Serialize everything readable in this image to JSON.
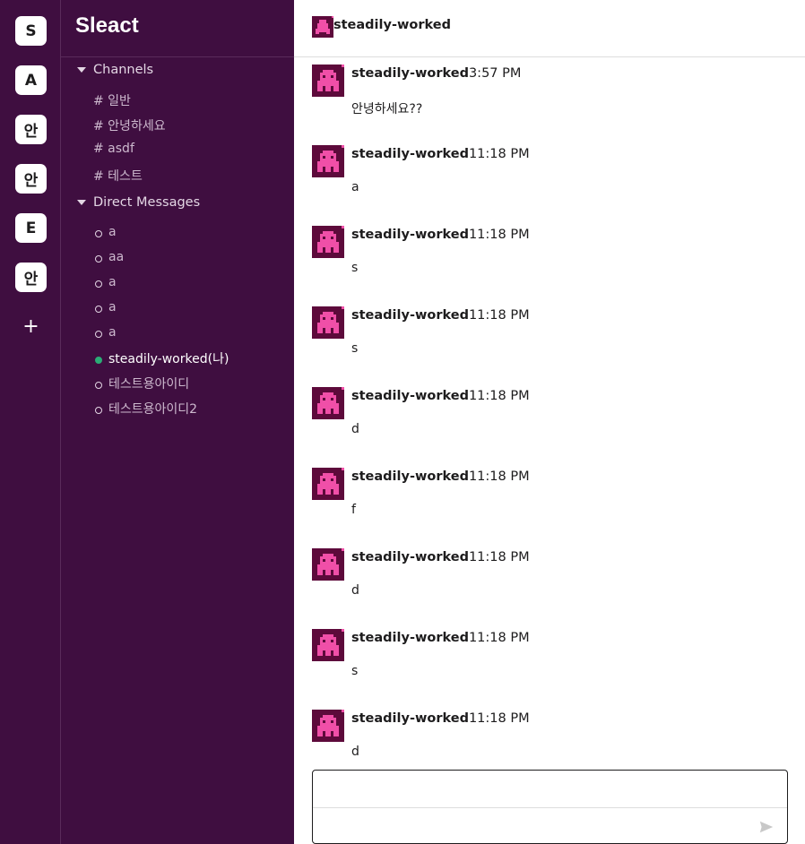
{
  "workspaces": [
    {
      "label": "S"
    },
    {
      "label": "A"
    },
    {
      "label": "안"
    },
    {
      "label": "안"
    },
    {
      "label": "E"
    },
    {
      "label": "안"
    }
  ],
  "add_workspace_label": "+",
  "workspace_name": "Sleact",
  "channels_section": {
    "label": "Channels",
    "items": [
      {
        "label": "# 일반"
      },
      {
        "label": "# 안녕하세요"
      },
      {
        "label": "# asdf"
      },
      {
        "label": "# 테스트"
      }
    ]
  },
  "dm_section": {
    "label": "Direct Messages",
    "items": [
      {
        "label": "a",
        "online": false
      },
      {
        "label": "aa",
        "online": false
      },
      {
        "label": "a",
        "online": false
      },
      {
        "label": "a",
        "online": false
      },
      {
        "label": "a",
        "online": false
      },
      {
        "label": "steadily-worked(나)",
        "online": true
      },
      {
        "label": "테스트용아이디",
        "online": false
      },
      {
        "label": "테스트용아이디2",
        "online": false
      }
    ]
  },
  "header": {
    "name": "steadily-worked",
    "avatar_icon": "pink-identicon-icon"
  },
  "messages": [
    {
      "author": "steadily-worked",
      "time": "3:57 PM",
      "text": "안녕하세요??"
    },
    {
      "author": "steadily-worked",
      "time": "11:18 PM",
      "text": "a"
    },
    {
      "author": "steadily-worked",
      "time": "11:18 PM",
      "text": "s"
    },
    {
      "author": "steadily-worked",
      "time": "11:18 PM",
      "text": "s"
    },
    {
      "author": "steadily-worked",
      "time": "11:18 PM",
      "text": "d"
    },
    {
      "author": "steadily-worked",
      "time": "11:18 PM",
      "text": "f"
    },
    {
      "author": "steadily-worked",
      "time": "11:18 PM",
      "text": "d"
    },
    {
      "author": "steadily-worked",
      "time": "11:18 PM",
      "text": "s"
    },
    {
      "author": "steadily-worked",
      "time": "11:18 PM",
      "text": "d"
    }
  ],
  "composer": {
    "value": "",
    "placeholder": ""
  },
  "colors": {
    "sidebar": "#3f0e40",
    "avatar_bg": "#5d0a3b",
    "avatar_fg": "#f04fa8",
    "online": "#2bac76"
  }
}
